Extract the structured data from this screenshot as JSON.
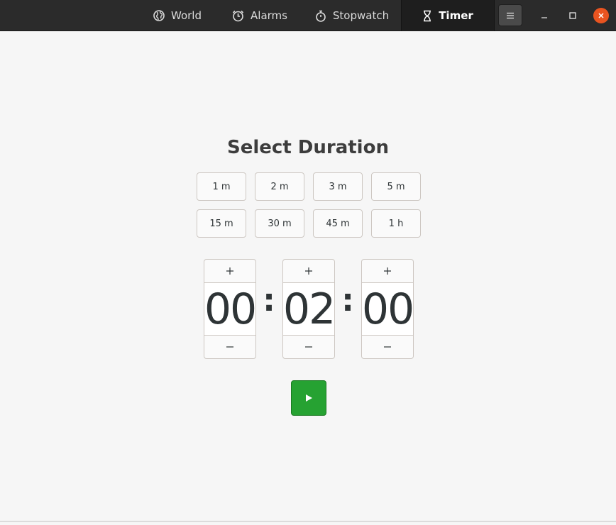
{
  "header": {
    "tabs": [
      {
        "label": "World",
        "icon": "globe-icon"
      },
      {
        "label": "Alarms",
        "icon": "alarm-clock-icon"
      },
      {
        "label": "Stopwatch",
        "icon": "stopwatch-icon"
      },
      {
        "label": "Timer",
        "icon": "hourglass-icon",
        "active": true
      }
    ],
    "menu_icon": "hamburger-menu-icon",
    "window_controls": [
      "minimize-icon",
      "maximize-icon",
      "close-icon"
    ]
  },
  "main": {
    "title": "Select Duration",
    "presets": [
      {
        "label": "1 m"
      },
      {
        "label": "2 m"
      },
      {
        "label": "3 m"
      },
      {
        "label": "5 m"
      },
      {
        "label": "15 m"
      },
      {
        "label": "30 m"
      },
      {
        "label": "45 m"
      },
      {
        "label": "1 h"
      }
    ],
    "duration": {
      "hours": "00",
      "minutes": "02",
      "seconds": "00",
      "separator": ":"
    },
    "start_icon": "play-icon"
  },
  "colors": {
    "headerbar": "#2b2b2b",
    "active_tab": "#1e1e1e",
    "start_button": "#26a232",
    "close_button": "#e95420",
    "background": "#f6f6f6"
  }
}
